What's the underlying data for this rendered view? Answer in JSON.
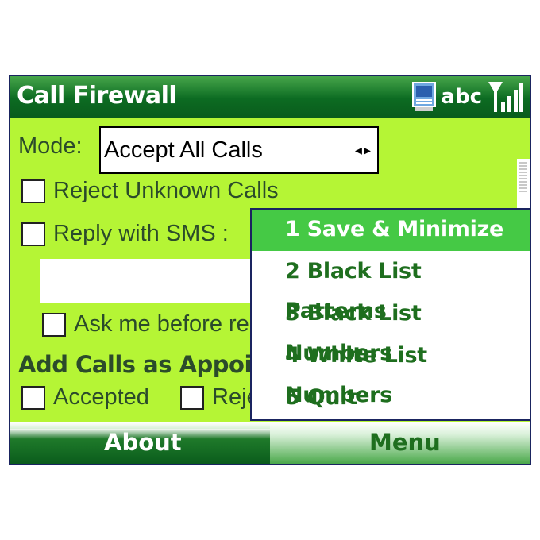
{
  "title_bar": {
    "app_title": "Call Firewall",
    "input_mode": "abc",
    "icons": [
      "device-icon",
      "signal-strength-icon"
    ]
  },
  "form": {
    "mode_label": "Mode:",
    "mode_value": "Accept All Calls",
    "mode_arrows": "◂▸",
    "reject_unknown_label": "Reject Unknown Calls",
    "reject_unknown_checked": false,
    "reply_sms_label": "Reply with SMS :",
    "reply_sms_checked": false,
    "sms_text_value": "",
    "ask_me_label": "Ask me before rep",
    "ask_me_checked": false,
    "appointments_heading": "Add Calls as Appointr",
    "accepted_label": "Accepted",
    "accepted_checked": false,
    "rejected_label": "Reje",
    "rejected_checked": false
  },
  "menu": {
    "items": [
      {
        "label": "1 Save & Minimize",
        "selected": true
      },
      {
        "label": "2 Black List Patterns",
        "selected": false
      },
      {
        "label": "3 Black List Numbers",
        "selected": false
      },
      {
        "label": "4 White List Numbers",
        "selected": false
      },
      {
        "label": "5 Quit",
        "selected": false
      }
    ]
  },
  "softkeys": {
    "left": "About",
    "right": "Menu"
  },
  "colors": {
    "background": "#b5f535",
    "title_bar": "#0c6b22",
    "menu_selected": "#45c945",
    "menu_text": "#1e6e1e"
  }
}
